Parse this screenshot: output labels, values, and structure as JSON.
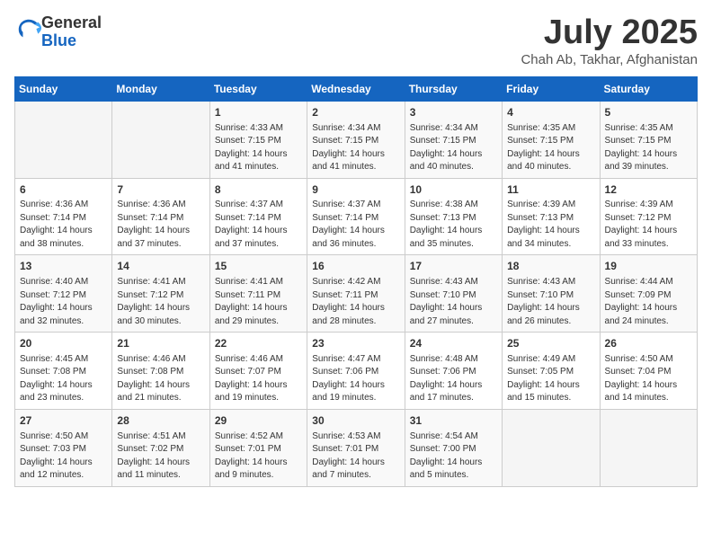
{
  "header": {
    "logo_line1": "General",
    "logo_line2": "Blue",
    "month_title": "July 2025",
    "subtitle": "Chah Ab, Takhar, Afghanistan"
  },
  "weekdays": [
    "Sunday",
    "Monday",
    "Tuesday",
    "Wednesday",
    "Thursday",
    "Friday",
    "Saturday"
  ],
  "weeks": [
    [
      {
        "day": "",
        "sunrise": "",
        "sunset": "",
        "daylight": ""
      },
      {
        "day": "",
        "sunrise": "",
        "sunset": "",
        "daylight": ""
      },
      {
        "day": "1",
        "sunrise": "Sunrise: 4:33 AM",
        "sunset": "Sunset: 7:15 PM",
        "daylight": "Daylight: 14 hours and 41 minutes."
      },
      {
        "day": "2",
        "sunrise": "Sunrise: 4:34 AM",
        "sunset": "Sunset: 7:15 PM",
        "daylight": "Daylight: 14 hours and 41 minutes."
      },
      {
        "day": "3",
        "sunrise": "Sunrise: 4:34 AM",
        "sunset": "Sunset: 7:15 PM",
        "daylight": "Daylight: 14 hours and 40 minutes."
      },
      {
        "day": "4",
        "sunrise": "Sunrise: 4:35 AM",
        "sunset": "Sunset: 7:15 PM",
        "daylight": "Daylight: 14 hours and 40 minutes."
      },
      {
        "day": "5",
        "sunrise": "Sunrise: 4:35 AM",
        "sunset": "Sunset: 7:15 PM",
        "daylight": "Daylight: 14 hours and 39 minutes."
      }
    ],
    [
      {
        "day": "6",
        "sunrise": "Sunrise: 4:36 AM",
        "sunset": "Sunset: 7:14 PM",
        "daylight": "Daylight: 14 hours and 38 minutes."
      },
      {
        "day": "7",
        "sunrise": "Sunrise: 4:36 AM",
        "sunset": "Sunset: 7:14 PM",
        "daylight": "Daylight: 14 hours and 37 minutes."
      },
      {
        "day": "8",
        "sunrise": "Sunrise: 4:37 AM",
        "sunset": "Sunset: 7:14 PM",
        "daylight": "Daylight: 14 hours and 37 minutes."
      },
      {
        "day": "9",
        "sunrise": "Sunrise: 4:37 AM",
        "sunset": "Sunset: 7:14 PM",
        "daylight": "Daylight: 14 hours and 36 minutes."
      },
      {
        "day": "10",
        "sunrise": "Sunrise: 4:38 AM",
        "sunset": "Sunset: 7:13 PM",
        "daylight": "Daylight: 14 hours and 35 minutes."
      },
      {
        "day": "11",
        "sunrise": "Sunrise: 4:39 AM",
        "sunset": "Sunset: 7:13 PM",
        "daylight": "Daylight: 14 hours and 34 minutes."
      },
      {
        "day": "12",
        "sunrise": "Sunrise: 4:39 AM",
        "sunset": "Sunset: 7:12 PM",
        "daylight": "Daylight: 14 hours and 33 minutes."
      }
    ],
    [
      {
        "day": "13",
        "sunrise": "Sunrise: 4:40 AM",
        "sunset": "Sunset: 7:12 PM",
        "daylight": "Daylight: 14 hours and 32 minutes."
      },
      {
        "day": "14",
        "sunrise": "Sunrise: 4:41 AM",
        "sunset": "Sunset: 7:12 PM",
        "daylight": "Daylight: 14 hours and 30 minutes."
      },
      {
        "day": "15",
        "sunrise": "Sunrise: 4:41 AM",
        "sunset": "Sunset: 7:11 PM",
        "daylight": "Daylight: 14 hours and 29 minutes."
      },
      {
        "day": "16",
        "sunrise": "Sunrise: 4:42 AM",
        "sunset": "Sunset: 7:11 PM",
        "daylight": "Daylight: 14 hours and 28 minutes."
      },
      {
        "day": "17",
        "sunrise": "Sunrise: 4:43 AM",
        "sunset": "Sunset: 7:10 PM",
        "daylight": "Daylight: 14 hours and 27 minutes."
      },
      {
        "day": "18",
        "sunrise": "Sunrise: 4:43 AM",
        "sunset": "Sunset: 7:10 PM",
        "daylight": "Daylight: 14 hours and 26 minutes."
      },
      {
        "day": "19",
        "sunrise": "Sunrise: 4:44 AM",
        "sunset": "Sunset: 7:09 PM",
        "daylight": "Daylight: 14 hours and 24 minutes."
      }
    ],
    [
      {
        "day": "20",
        "sunrise": "Sunrise: 4:45 AM",
        "sunset": "Sunset: 7:08 PM",
        "daylight": "Daylight: 14 hours and 23 minutes."
      },
      {
        "day": "21",
        "sunrise": "Sunrise: 4:46 AM",
        "sunset": "Sunset: 7:08 PM",
        "daylight": "Daylight: 14 hours and 21 minutes."
      },
      {
        "day": "22",
        "sunrise": "Sunrise: 4:46 AM",
        "sunset": "Sunset: 7:07 PM",
        "daylight": "Daylight: 14 hours and 19 minutes."
      },
      {
        "day": "23",
        "sunrise": "Sunrise: 4:47 AM",
        "sunset": "Sunset: 7:06 PM",
        "daylight": "Daylight: 14 hours and 19 minutes."
      },
      {
        "day": "24",
        "sunrise": "Sunrise: 4:48 AM",
        "sunset": "Sunset: 7:06 PM",
        "daylight": "Daylight: 14 hours and 17 minutes."
      },
      {
        "day": "25",
        "sunrise": "Sunrise: 4:49 AM",
        "sunset": "Sunset: 7:05 PM",
        "daylight": "Daylight: 14 hours and 15 minutes."
      },
      {
        "day": "26",
        "sunrise": "Sunrise: 4:50 AM",
        "sunset": "Sunset: 7:04 PM",
        "daylight": "Daylight: 14 hours and 14 minutes."
      }
    ],
    [
      {
        "day": "27",
        "sunrise": "Sunrise: 4:50 AM",
        "sunset": "Sunset: 7:03 PM",
        "daylight": "Daylight: 14 hours and 12 minutes."
      },
      {
        "day": "28",
        "sunrise": "Sunrise: 4:51 AM",
        "sunset": "Sunset: 7:02 PM",
        "daylight": "Daylight: 14 hours and 11 minutes."
      },
      {
        "day": "29",
        "sunrise": "Sunrise: 4:52 AM",
        "sunset": "Sunset: 7:01 PM",
        "daylight": "Daylight: 14 hours and 9 minutes."
      },
      {
        "day": "30",
        "sunrise": "Sunrise: 4:53 AM",
        "sunset": "Sunset: 7:01 PM",
        "daylight": "Daylight: 14 hours and 7 minutes."
      },
      {
        "day": "31",
        "sunrise": "Sunrise: 4:54 AM",
        "sunset": "Sunset: 7:00 PM",
        "daylight": "Daylight: 14 hours and 5 minutes."
      },
      {
        "day": "",
        "sunrise": "",
        "sunset": "",
        "daylight": ""
      },
      {
        "day": "",
        "sunrise": "",
        "sunset": "",
        "daylight": ""
      }
    ]
  ]
}
